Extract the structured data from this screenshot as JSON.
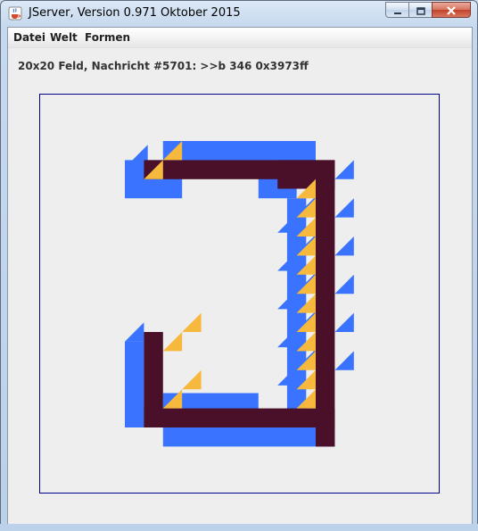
{
  "window": {
    "title": "JServer, Version 0.971 Oktober 2015",
    "icon": "java-cup-icon",
    "controls": [
      "minimize-icon",
      "maximize-icon",
      "close-icon"
    ]
  },
  "menu": {
    "items": [
      "Datei",
      "Welt",
      "Formen"
    ]
  },
  "status": {
    "text": "20x20 Feld, Nachricht #5701: >>b 346 0x3973ff"
  },
  "board": {
    "size": 20,
    "colors": {
      "background": "#eeeeee",
      "border": "#00008b",
      "blue": "#3973ff",
      "maroon": "#4a102a",
      "yellow": "#f7b93d"
    }
  }
}
